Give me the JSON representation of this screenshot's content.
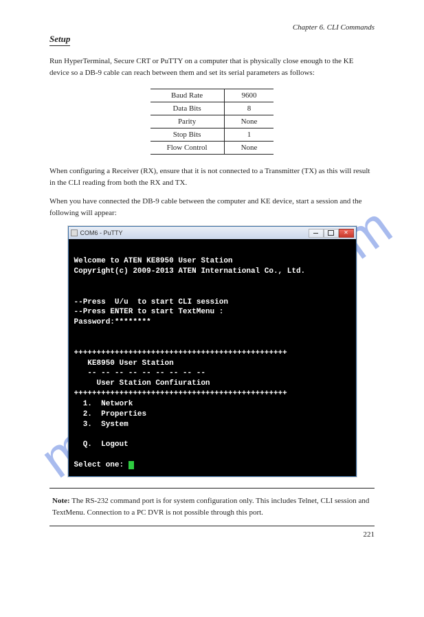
{
  "watermark": {
    "text": "manualshive.com"
  },
  "header_right": "Chapter 6. CLI Commands",
  "heading": "Setup",
  "para1": "Run HyperTerminal, Secure CRT or PuTTY on a computer that is physically close enough to the KE device so a DB-9 cable can reach between them and set its serial parameters as follows:",
  "table": {
    "rows": [
      {
        "param": "Baud Rate",
        "value": "9600"
      },
      {
        "param": "Data Bits",
        "value": "8"
      },
      {
        "param": "Parity",
        "value": "None"
      },
      {
        "param": "Stop Bits",
        "value": "1"
      },
      {
        "param": "Flow Control",
        "value": "None"
      }
    ]
  },
  "para2_a": "When configuring a Receiver (RX), ensure that it is not connected to a Transmitter (TX) as this will result in the CLI reading from both the RX and TX.",
  "para2_b": "When you have connected the DB-9 cable between the computer and KE device, start a session and the following will appear:",
  "terminal": {
    "title": "COM6 - PuTTY",
    "lines": [
      "",
      "Welcome to ATEN KE8950 User Station",
      "Copyright(c) 2009-2013 ATEN International Co., Ltd.",
      "",
      "",
      "--Press  U/u  to start CLI session",
      "--Press ENTER to start TextMenu :",
      "Password:********",
      "",
      "",
      "+++++++++++++++++++++++++++++++++++++++++++++++",
      "   KE8950 User Station",
      "   -- -- -- -- -- -- -- -- --",
      "     User Station Confiuration",
      "+++++++++++++++++++++++++++++++++++++++++++++++",
      "  1.  Network",
      "  2.  Properties",
      "  3.  System",
      "",
      "  Q.  Logout",
      "",
      "Select one: "
    ]
  },
  "note": {
    "label": "Note:",
    "text": "The RS-232 command port is for system configuration only. This includes Telnet, CLI session and TextMenu. Connection to a PC DVR is not possible through this port."
  },
  "page_number": "221"
}
